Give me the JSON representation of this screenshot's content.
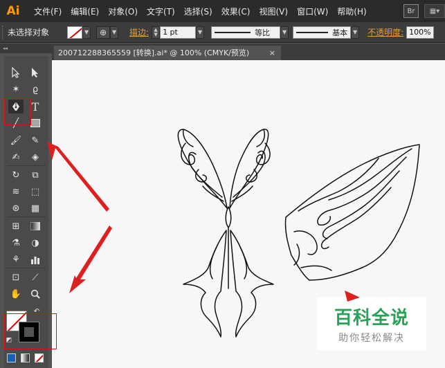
{
  "app": {
    "logo_text": "Ai",
    "bridge_badge": "Br"
  },
  "menu": [
    "文件(F)",
    "编辑(E)",
    "对象(O)",
    "文字(T)",
    "选择(S)",
    "效果(C)",
    "视图(V)",
    "窗口(W)",
    "帮助(H)"
  ],
  "control": {
    "selection_status": "未选择对象",
    "stroke_label": "描边:",
    "stroke_weight": "1 pt",
    "profile_label": "等比",
    "brush_label": "基本",
    "opacity_label": "不透明度:",
    "opacity_value": "100%"
  },
  "document": {
    "tab_title": "200712288365559  [转换].ai* @ 100% (CMYK/预览)",
    "close_glyph": "×"
  },
  "watermark": {
    "title": "百科全说",
    "subtitle": "助你轻松解决"
  },
  "colors": {
    "accent_orange": "#ff9a00",
    "annotation_red": "#dd1f1f",
    "watermark_green": "#2aa157"
  }
}
